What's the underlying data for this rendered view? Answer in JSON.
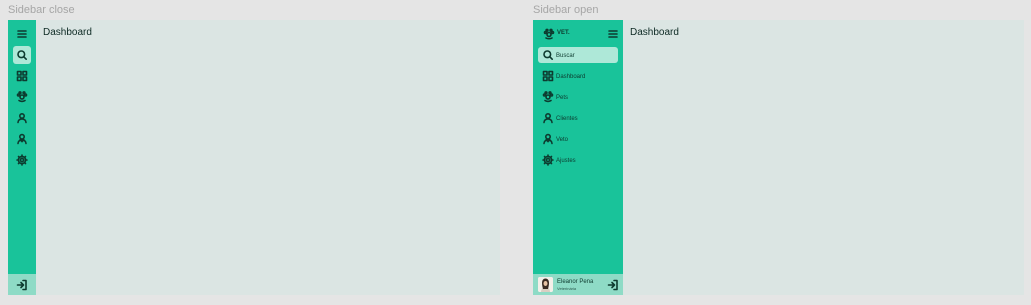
{
  "frames": {
    "closed": {
      "label": "Sidebar close",
      "page_title": "Dashboard",
      "icons": [
        "menu-icon",
        "search-icon",
        "dashboard-icon",
        "paw-icon",
        "user-icon",
        "vet-icon",
        "settings-icon",
        "logout-icon"
      ]
    },
    "open": {
      "label": "Sidebar open",
      "brand": "VET.",
      "page_title": "Dashboard",
      "nav": [
        {
          "label": "Buscar",
          "icon": "search-icon"
        },
        {
          "label": "Dashboard",
          "icon": "dashboard-icon"
        },
        {
          "label": "Pets",
          "icon": "paw-icon"
        },
        {
          "label": "Clientes",
          "icon": "user-icon"
        },
        {
          "label": "Veto",
          "icon": "vet-icon"
        },
        {
          "label": "Ajustes",
          "icon": "settings-icon"
        }
      ],
      "user": {
        "name": "Eleanor Pena",
        "role": "Veterinária"
      }
    }
  },
  "colors": {
    "sidebar": "#19c39a",
    "sidebar_bottom": "#8edbc6",
    "content": "#dbe5e3",
    "active_item": "#aee8d8"
  }
}
